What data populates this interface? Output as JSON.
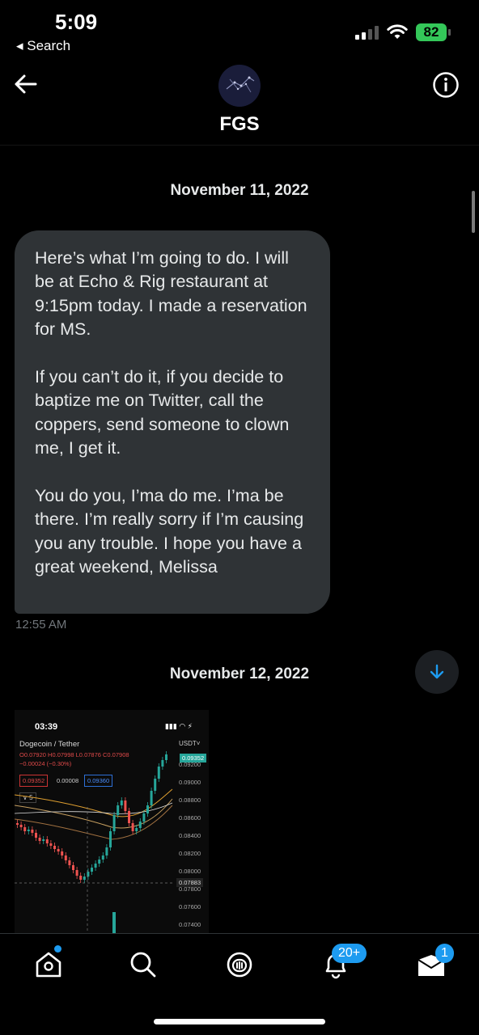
{
  "status_bar": {
    "time": "5:09",
    "back_label": "◂ Search",
    "battery": "82"
  },
  "header": {
    "title": "FGS",
    "back_icon": "arrow-left-icon",
    "info_icon": "info-icon"
  },
  "conversation": {
    "date_1": "November 11, 2022",
    "message": {
      "paragraphs": [
        "Here’s what I’m going to do. I will be at Echo & Rig restaurant at 9:15pm today. I made a reservation for MS.",
        "If you can’t do it, if you decide to baptize me on Twitter, call the coppers, send someone to clown me, I get it.",
        "You do you, I’ma do me. I’ma be there. I’m really sorry if I’m causing you any trouble. I hope you have a great weekend, Melissa"
      ],
      "time": "12:55 AM"
    },
    "date_2": "November 12, 2022",
    "image_message": {
      "time": "03:39",
      "pair": "Dogecoin / Tether",
      "ohlc": "O0.07920 H0.07998 L0.07876 C0.07908",
      "change": "−0.00024 (−0.30%)",
      "bid": "0.09352",
      "spread": "0.00008",
      "ask": "0.09360",
      "interval": "∨ 5",
      "currency": "USDT˅",
      "live_price": "0.09352",
      "price_levels": [
        "0.09200",
        "0.09000",
        "0.08800",
        "0.08600",
        "0.08400",
        "0.08200",
        "0.08000",
        "0.07800",
        "0.07600",
        "0.07400"
      ],
      "marker_price": "0.07883"
    }
  },
  "bottom_nav": {
    "items": [
      {
        "icon": "home-icon"
      },
      {
        "icon": "search-icon"
      },
      {
        "icon": "spaces-icon"
      },
      {
        "icon": "bell-icon",
        "badge": "20+"
      },
      {
        "icon": "mail-icon",
        "badge": "1"
      }
    ]
  },
  "colors": {
    "accent": "#1d9bf0",
    "bubble": "#2f3336",
    "battery": "#34c759"
  }
}
